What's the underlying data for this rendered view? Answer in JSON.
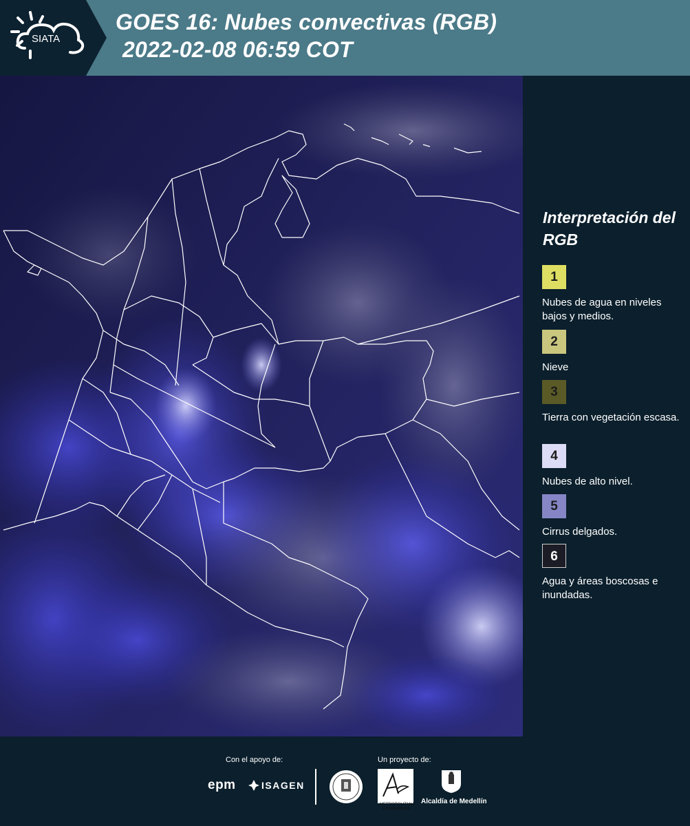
{
  "header": {
    "logo_text": "SIATA",
    "title_line1": "GOES 16: Nubes convectivas (RGB)",
    "title_line2": "2022-02-08 06:59 COT"
  },
  "map": {
    "description_icon": "satellite-rgb-map"
  },
  "legend": {
    "title": "Interpretación del RGB",
    "items": [
      {
        "number": "1",
        "label": "Nubes de agua en niveles bajos y medios.",
        "color": "#dede62"
      },
      {
        "number": "2",
        "label": "Nieve",
        "color": "#c9c67e"
      },
      {
        "number": "3",
        "label": "Tierra con vegetación escasa.",
        "color": "#5a5a26"
      },
      {
        "number": "4",
        "label": "Nubes de alto nivel.",
        "color": "#dcdcf6"
      },
      {
        "number": "5",
        "label": "Cirrus delgados.",
        "color": "#8686c6"
      },
      {
        "number": "6",
        "label": "Agua y áreas boscosas e inundadas.",
        "color": "#1c1c26"
      }
    ]
  },
  "footer": {
    "support_label": "Con el apoyo de:",
    "project_label": "Un proyecto de:",
    "epm": "epm",
    "isagen": "ISAGEN",
    "area_small": "METROPOLITANA Valle de Aburrá",
    "alcaldia": "Alcaldía de Medellín"
  }
}
